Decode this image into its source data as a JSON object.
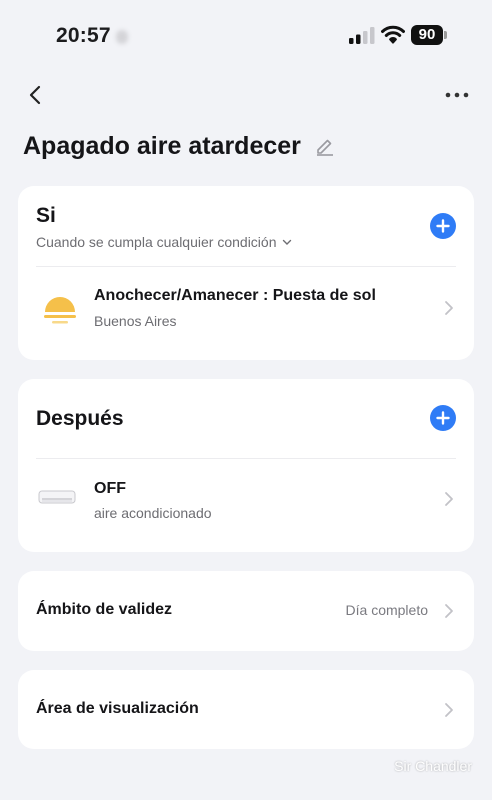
{
  "status_bar": {
    "time": "20:57",
    "battery": "90",
    "icons": [
      "signal-icon",
      "wifi-icon",
      "battery-icon"
    ]
  },
  "header": {
    "back_icon": "chevron-left-icon",
    "more_icon": "more-dots-icon",
    "title": "Apagado aire atardecer",
    "edit_icon": "pencil-icon"
  },
  "if_section": {
    "title": "Si",
    "condition_mode": "Cuando se cumpla cualquier condición",
    "add_icon": "plus-icon",
    "items": [
      {
        "title": "Anochecer/Amanecer : Puesta de sol",
        "subtitle": "Buenos Aires",
        "icon": "sunset-icon"
      }
    ]
  },
  "then_section": {
    "title": "Después",
    "add_icon": "plus-icon",
    "items": [
      {
        "title": "OFF",
        "subtitle": "aire acondicionado",
        "icon": "air-conditioner-icon"
      }
    ]
  },
  "validity": {
    "label": "Ámbito de validez",
    "value": "Día completo"
  },
  "display_area": {
    "label": "Área de visualización"
  },
  "watermark": "Sir Chandler",
  "colors": {
    "background": "#f2f3f7",
    "card": "#ffffff",
    "accent": "#2f7cf6",
    "sun": "#f5c04a"
  }
}
